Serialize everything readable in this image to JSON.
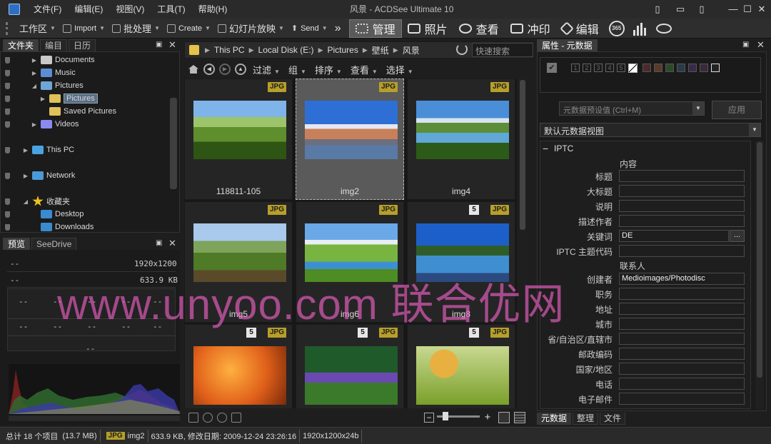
{
  "window": {
    "title": "风景 - ACDSee Ultimate 10",
    "menu": [
      "文件(F)",
      "编辑(E)",
      "视图(V)",
      "工具(T)",
      "帮助(H)"
    ]
  },
  "toolbar": {
    "workspace": "工作区",
    "import": "Import",
    "batch": "批处理",
    "create": "Create",
    "slideshow": "幻灯片放映",
    "send": "Send",
    "overflow": "»",
    "modes": [
      "管理",
      "照片",
      "查看",
      "冲印",
      "编辑"
    ],
    "counter_365": "365"
  },
  "left_panel": {
    "tabs": [
      "文件夹",
      "编目",
      "日历"
    ],
    "tree": [
      {
        "label": "Documents",
        "indent": 2,
        "arrow": "▶",
        "icon": "documents-icon"
      },
      {
        "label": "Music",
        "indent": 2,
        "arrow": "▶",
        "icon": "music-icon"
      },
      {
        "label": "Pictures",
        "indent": 2,
        "arrow": "◢",
        "icon": "pictures-icon"
      },
      {
        "label": "Pictures",
        "indent": 3,
        "arrow": "▶",
        "icon": "folder-icon",
        "selected": true
      },
      {
        "label": "Saved Pictures",
        "indent": 3,
        "arrow": "",
        "icon": "folder-icon"
      },
      {
        "label": "Videos",
        "indent": 2,
        "arrow": "▶",
        "icon": "videos-icon"
      },
      {
        "label": "This PC",
        "indent": 1,
        "arrow": "▶",
        "icon": "computer-icon"
      },
      {
        "label": "Network",
        "indent": 1,
        "arrow": "▶",
        "icon": "network-icon"
      },
      {
        "label": "收藏夹",
        "indent": 1,
        "arrow": "◢",
        "icon": "star-icon"
      },
      {
        "label": "Desktop",
        "indent": 2,
        "arrow": "",
        "icon": "desktop-icon"
      },
      {
        "label": "Downloads",
        "indent": 2,
        "arrow": "",
        "icon": "downloads-icon"
      }
    ]
  },
  "preview_panel": {
    "tabs": [
      "预览",
      "SeeDrive"
    ],
    "dash": "--",
    "resolution": "1920x1200",
    "size": "633.9 KB"
  },
  "path_bar": {
    "crumbs": [
      "This PC",
      "Local Disk (E:)",
      "Pictures",
      "壁纸",
      "风景"
    ],
    "search_placeholder": "快速搜索"
  },
  "filter_bar": {
    "items": [
      "过滤",
      "组",
      "排序",
      "查看",
      "选择"
    ]
  },
  "thumbnails": [
    {
      "label": "118811-105",
      "badge": "JPG",
      "rating": "",
      "selected": false,
      "scene": "hills"
    },
    {
      "label": "img2",
      "badge": "JPG",
      "rating": "",
      "selected": true,
      "scene": "town"
    },
    {
      "label": "img4",
      "badge": "JPG",
      "rating": "",
      "selected": false,
      "scene": "river"
    },
    {
      "label": "img5",
      "badge": "JPG",
      "rating": "",
      "selected": false,
      "scene": "vineyard"
    },
    {
      "label": "img6",
      "badge": "JPG",
      "rating": "",
      "selected": false,
      "scene": "meadow"
    },
    {
      "label": "img8",
      "badge": "JPG",
      "rating": "5",
      "selected": false,
      "scene": "lake"
    },
    {
      "label": "",
      "badge": "JPG",
      "rating": "5",
      "selected": false,
      "scene": "autumn"
    },
    {
      "label": "",
      "badge": "JPG",
      "rating": "5",
      "selected": false,
      "scene": "flowers"
    },
    {
      "label": "",
      "badge": "JPG",
      "rating": "5",
      "selected": false,
      "scene": "leaves"
    }
  ],
  "meta_panel": {
    "title": "属性 - 元数据",
    "rating_numbers": [
      "1",
      "2",
      "3",
      "4",
      "5"
    ],
    "preset_placeholder": "元数据预设值 (Ctrl+M)",
    "apply": "应用",
    "view": "默认元数据视图",
    "section": "IPTC",
    "content_header": "内容",
    "contact_header": "联系人",
    "fields_a": [
      {
        "label": "标题",
        "value": ""
      },
      {
        "label": "大标题",
        "value": ""
      },
      {
        "label": "说明",
        "value": ""
      },
      {
        "label": "描述作者",
        "value": ""
      },
      {
        "label": "关键词",
        "value": "DE"
      },
      {
        "label": "IPTC 主题代码",
        "value": ""
      }
    ],
    "fields_b": [
      {
        "label": "创建者",
        "value": "Medioimages/Photodisc"
      },
      {
        "label": "职务",
        "value": ""
      },
      {
        "label": "地址",
        "value": ""
      },
      {
        "label": "城市",
        "value": ""
      },
      {
        "label": "省/自治区/直辖市",
        "value": ""
      },
      {
        "label": "邮政编码",
        "value": ""
      },
      {
        "label": "国家/地区",
        "value": ""
      },
      {
        "label": "电话",
        "value": ""
      },
      {
        "label": "电子邮件",
        "value": ""
      }
    ],
    "ellipsis": "...",
    "bottom_tabs": [
      "元数据",
      "整理",
      "文件"
    ]
  },
  "status": {
    "total": "总计 18 个项目",
    "total_size": "(13.7 MB)",
    "badge": "JPG",
    "current": "img2",
    "file_info": "633.9 KB, 修改日期: 2009-12-24 23:26:16",
    "dims": "1920x1200x24b"
  },
  "watermark": "www.unyoo.com 联合优网",
  "colors": {
    "badge": "#b69f2a",
    "selected_tile": "#5a5a5a",
    "watermark": "#eb5fc3"
  }
}
